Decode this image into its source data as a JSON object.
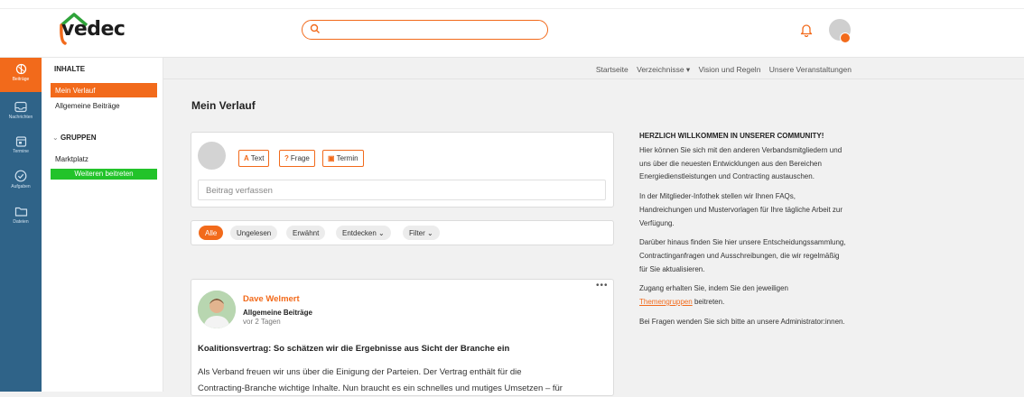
{
  "brand": {
    "logo_text": "vedec",
    "accent": "#f26a1b",
    "rail_color": "#2f6388",
    "join_color": "#22c32a"
  },
  "search": {
    "placeholder": ""
  },
  "rail": [
    {
      "label": "Beiträge",
      "icon": "contributions-icon",
      "active": true
    },
    {
      "label": "Nachrichten",
      "icon": "inbox-icon"
    },
    {
      "label": "Termine",
      "icon": "calendar-icon"
    },
    {
      "label": "Aufgaben",
      "icon": "check-circle-icon"
    },
    {
      "label": "Dateien",
      "icon": "folder-icon"
    }
  ],
  "sidebar": {
    "heading": "INHALTE",
    "items": [
      "Mein Verlauf",
      "Allgemeine Beiträge"
    ],
    "groups_heading": "GRUPPEN",
    "groups": [
      "Marktplatz"
    ],
    "join_button": "Weiteren beitreten"
  },
  "nav": {
    "links": [
      "Startseite",
      "Verzeichnisse ▾",
      "Vision und Regeln",
      "Unsere Veranstaltungen"
    ]
  },
  "main": {
    "title": "Mein Verlauf",
    "composer": {
      "buttons": [
        {
          "icon_text": "A",
          "label": "Text"
        },
        {
          "icon_text": "?",
          "label": "Frage"
        },
        {
          "icon_text": "▣",
          "label": "Termin"
        }
      ],
      "placeholder": "Beitrag verfassen"
    },
    "filters": [
      "Alle",
      "Ungelesen",
      "Erwähnt",
      "Entdecken ⌄",
      "Filter ⌄"
    ],
    "post": {
      "author": "Dave Welmert",
      "category": "Allgemeine Beiträge",
      "time": "vor 2 Tagen",
      "title": "Koalitionsvertrag: So schätzen wir die Ergebnisse aus Sicht der Branche ein",
      "body_line1": "Als Verband freuen wir uns über die Einigung der Parteien. Der Vertrag enthält für die",
      "body_line2": "Contracting-Branche wichtige Inhalte. Nun braucht es ein schnelles und mutiges Umsetzen – für",
      "more": "•••"
    }
  },
  "welcome": {
    "heading": "HERZLICH WILLKOMMEN IN UNSERER COMMUNITY!",
    "p1": "Hier können Sie sich mit den anderen Verbandsmitgliedern und uns über die neuesten Entwicklungen aus den Bereichen Energiedienstleistungen und Contracting austauschen.",
    "p2": "In der Mitglieder-Infothek stellen wir Ihnen FAQs, Handreichungen und Mustervorlagen für Ihre tägliche Arbeit zur Verfügung.",
    "p3": "Darüber hinaus finden Sie hier unsere Entscheidungssammlung, Contractinganfragen und Ausschreibungen, die wir regelmäßig für Sie aktualisieren.",
    "p4_prefix": "Zugang erhalten Sie, indem Sie den jeweiligen",
    "p4_link": "Themengruppen",
    "p4_suffix": " beitreten.",
    "p5": "Bei Fragen wenden Sie sich bitte an unsere Administrator:innen."
  }
}
